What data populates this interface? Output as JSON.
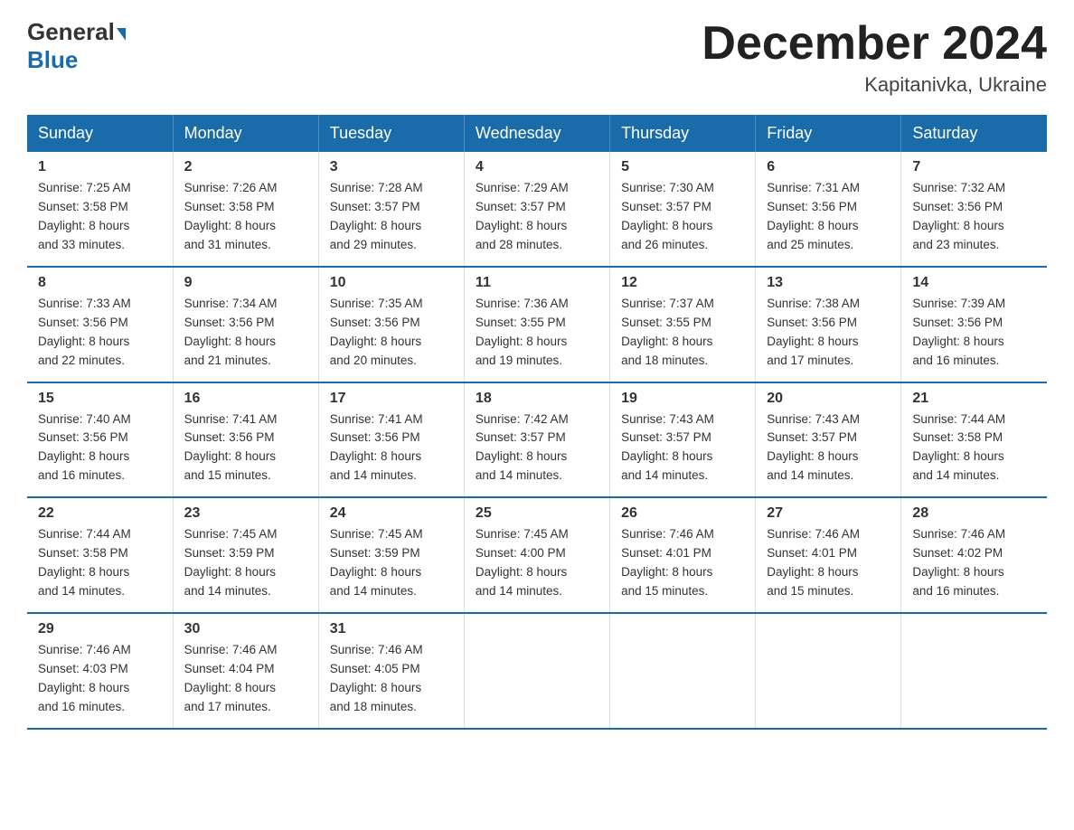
{
  "logo": {
    "general": "General",
    "blue": "Blue"
  },
  "title": {
    "month_year": "December 2024",
    "location": "Kapitanivka, Ukraine"
  },
  "weekdays": [
    "Sunday",
    "Monday",
    "Tuesday",
    "Wednesday",
    "Thursday",
    "Friday",
    "Saturday"
  ],
  "weeks": [
    [
      {
        "day": "1",
        "sunrise": "7:25 AM",
        "sunset": "3:58 PM",
        "daylight": "8 hours and 33 minutes."
      },
      {
        "day": "2",
        "sunrise": "7:26 AM",
        "sunset": "3:58 PM",
        "daylight": "8 hours and 31 minutes."
      },
      {
        "day": "3",
        "sunrise": "7:28 AM",
        "sunset": "3:57 PM",
        "daylight": "8 hours and 29 minutes."
      },
      {
        "day": "4",
        "sunrise": "7:29 AM",
        "sunset": "3:57 PM",
        "daylight": "8 hours and 28 minutes."
      },
      {
        "day": "5",
        "sunrise": "7:30 AM",
        "sunset": "3:57 PM",
        "daylight": "8 hours and 26 minutes."
      },
      {
        "day": "6",
        "sunrise": "7:31 AM",
        "sunset": "3:56 PM",
        "daylight": "8 hours and 25 minutes."
      },
      {
        "day": "7",
        "sunrise": "7:32 AM",
        "sunset": "3:56 PM",
        "daylight": "8 hours and 23 minutes."
      }
    ],
    [
      {
        "day": "8",
        "sunrise": "7:33 AM",
        "sunset": "3:56 PM",
        "daylight": "8 hours and 22 minutes."
      },
      {
        "day": "9",
        "sunrise": "7:34 AM",
        "sunset": "3:56 PM",
        "daylight": "8 hours and 21 minutes."
      },
      {
        "day": "10",
        "sunrise": "7:35 AM",
        "sunset": "3:56 PM",
        "daylight": "8 hours and 20 minutes."
      },
      {
        "day": "11",
        "sunrise": "7:36 AM",
        "sunset": "3:55 PM",
        "daylight": "8 hours and 19 minutes."
      },
      {
        "day": "12",
        "sunrise": "7:37 AM",
        "sunset": "3:55 PM",
        "daylight": "8 hours and 18 minutes."
      },
      {
        "day": "13",
        "sunrise": "7:38 AM",
        "sunset": "3:56 PM",
        "daylight": "8 hours and 17 minutes."
      },
      {
        "day": "14",
        "sunrise": "7:39 AM",
        "sunset": "3:56 PM",
        "daylight": "8 hours and 16 minutes."
      }
    ],
    [
      {
        "day": "15",
        "sunrise": "7:40 AM",
        "sunset": "3:56 PM",
        "daylight": "8 hours and 16 minutes."
      },
      {
        "day": "16",
        "sunrise": "7:41 AM",
        "sunset": "3:56 PM",
        "daylight": "8 hours and 15 minutes."
      },
      {
        "day": "17",
        "sunrise": "7:41 AM",
        "sunset": "3:56 PM",
        "daylight": "8 hours and 14 minutes."
      },
      {
        "day": "18",
        "sunrise": "7:42 AM",
        "sunset": "3:57 PM",
        "daylight": "8 hours and 14 minutes."
      },
      {
        "day": "19",
        "sunrise": "7:43 AM",
        "sunset": "3:57 PM",
        "daylight": "8 hours and 14 minutes."
      },
      {
        "day": "20",
        "sunrise": "7:43 AM",
        "sunset": "3:57 PM",
        "daylight": "8 hours and 14 minutes."
      },
      {
        "day": "21",
        "sunrise": "7:44 AM",
        "sunset": "3:58 PM",
        "daylight": "8 hours and 14 minutes."
      }
    ],
    [
      {
        "day": "22",
        "sunrise": "7:44 AM",
        "sunset": "3:58 PM",
        "daylight": "8 hours and 14 minutes."
      },
      {
        "day": "23",
        "sunrise": "7:45 AM",
        "sunset": "3:59 PM",
        "daylight": "8 hours and 14 minutes."
      },
      {
        "day": "24",
        "sunrise": "7:45 AM",
        "sunset": "3:59 PM",
        "daylight": "8 hours and 14 minutes."
      },
      {
        "day": "25",
        "sunrise": "7:45 AM",
        "sunset": "4:00 PM",
        "daylight": "8 hours and 14 minutes."
      },
      {
        "day": "26",
        "sunrise": "7:46 AM",
        "sunset": "4:01 PM",
        "daylight": "8 hours and 15 minutes."
      },
      {
        "day": "27",
        "sunrise": "7:46 AM",
        "sunset": "4:01 PM",
        "daylight": "8 hours and 15 minutes."
      },
      {
        "day": "28",
        "sunrise": "7:46 AM",
        "sunset": "4:02 PM",
        "daylight": "8 hours and 16 minutes."
      }
    ],
    [
      {
        "day": "29",
        "sunrise": "7:46 AM",
        "sunset": "4:03 PM",
        "daylight": "8 hours and 16 minutes."
      },
      {
        "day": "30",
        "sunrise": "7:46 AM",
        "sunset": "4:04 PM",
        "daylight": "8 hours and 17 minutes."
      },
      {
        "day": "31",
        "sunrise": "7:46 AM",
        "sunset": "4:05 PM",
        "daylight": "8 hours and 18 minutes."
      },
      null,
      null,
      null,
      null
    ]
  ],
  "labels": {
    "sunrise": "Sunrise:",
    "sunset": "Sunset:",
    "daylight": "Daylight:"
  }
}
